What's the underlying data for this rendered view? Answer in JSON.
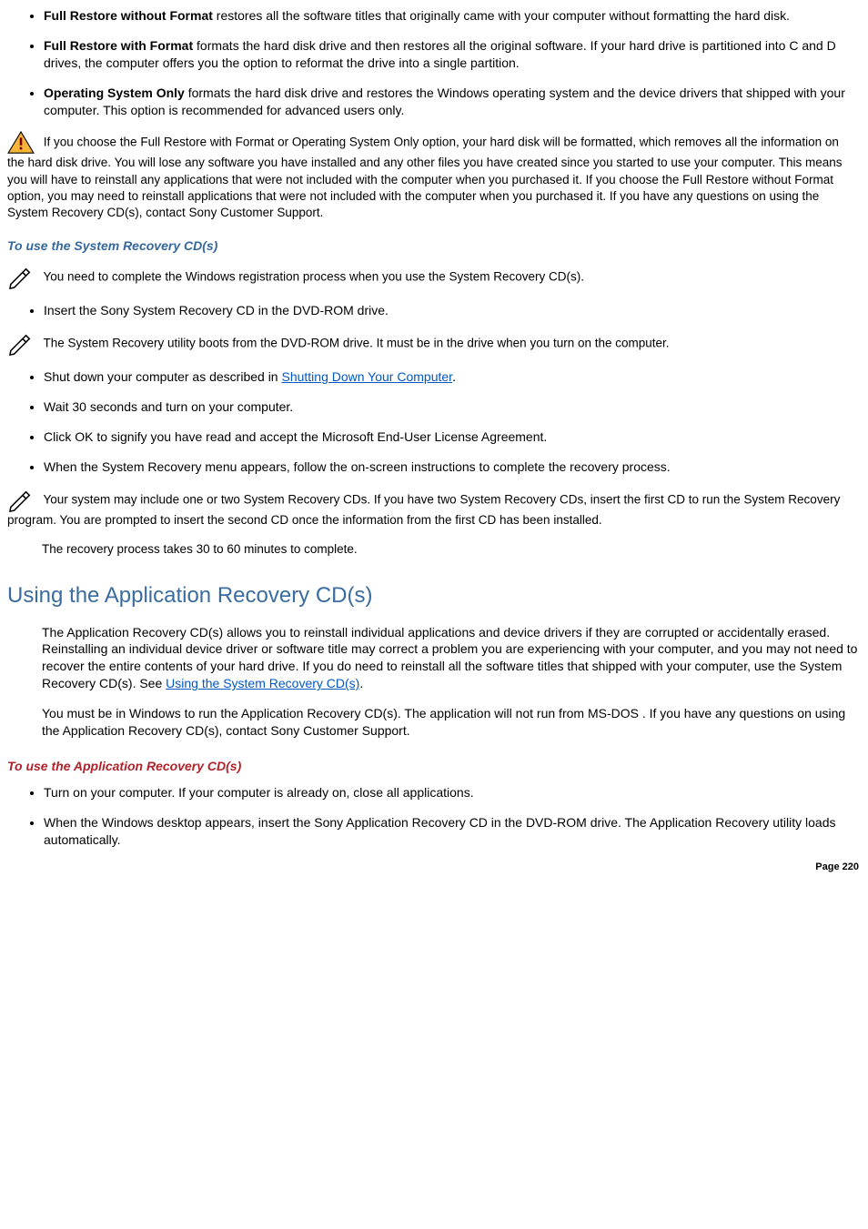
{
  "options_list": [
    {
      "label": "Full Restore without Format",
      "desc": " restores all the software titles that originally came with your computer without formatting the hard disk."
    },
    {
      "label": "Full Restore with Format",
      "desc": " formats the hard disk drive and then restores all the original software. If your hard drive is partitioned into C and D drives, the computer offers you the option to reformat the drive into a single partition."
    },
    {
      "label": "Operating System Only",
      "desc": " formats the hard disk drive and restores the Windows operating system and the device drivers that shipped with your computer. This option is recommended for advanced users only."
    }
  ],
  "warning1": " If you choose the Full Restore with Format or Operating System Only option, your hard disk will be formatted, which removes all the information on the hard disk drive. You will lose any software you have installed and any other files you have created since you started to use your computer. This means you will have to reinstall any applications that were not included with the computer when you purchased it. If you choose the Full Restore without Format option, you may need to reinstall applications that were not included with the computer when you purchased it. If you have any questions on using the System Recovery CD(s), contact Sony Customer Support.",
  "heading_use_sysrec": "To use the System Recovery CD(s)",
  "note1": " You need to complete the Windows registration process when you use the System Recovery CD(s).",
  "step_insert": "Insert the Sony System Recovery CD in the DVD-ROM drive.",
  "note2": " The System Recovery utility boots from the DVD-ROM drive. It must be in the drive when you turn on the computer.",
  "steps2": [
    {
      "pre": "Shut down your computer as described in ",
      "link": "Shutting Down Your Computer",
      "post": "."
    },
    {
      "pre": "Wait 30 seconds and turn on your computer."
    },
    {
      "pre": "Click OK to signify you have read and accept the Microsoft End-User License Agreement."
    },
    {
      "pre": "When the System Recovery menu appears, follow the on-screen instructions to complete the recovery process."
    }
  ],
  "note3": " Your system may include one or two System Recovery CDs. If you have two System Recovery CDs, insert the first CD to run the System Recovery program. You are prompted to insert the second CD once the information from the first CD has been installed.",
  "recovery_time": "The recovery process takes 30 to 60 minutes to complete.",
  "section_apprec": "Using the Application Recovery CD(s)",
  "apprec_p1_pre": "The Application Recovery CD(s) allows you to reinstall individual applications and device drivers if they are corrupted or accidentally erased. Reinstalling an individual device driver or software title may correct a problem you are experiencing with your computer, and you may not need to recover the entire contents of your hard drive. If you do need to reinstall all the software titles that shipped with your computer, use the System Recovery CD(s). See ",
  "apprec_p1_link": "Using the System Recovery CD(s)",
  "apprec_p1_post": ".",
  "apprec_p2": "You must be in Windows to run the Application Recovery CD(s). The application will not run from MS-DOS  . If you have any questions on using the Application Recovery CD(s), contact Sony Customer Support.",
  "heading_use_apprec": "To use the Application Recovery CD(s)",
  "apprec_steps": [
    "Turn on your computer. If your computer is already on, close all applications.",
    "When the Windows desktop appears, insert the Sony Application Recovery CD in the DVD-ROM drive. The Application Recovery utility loads automatically."
  ],
  "page_number": "Page 220"
}
